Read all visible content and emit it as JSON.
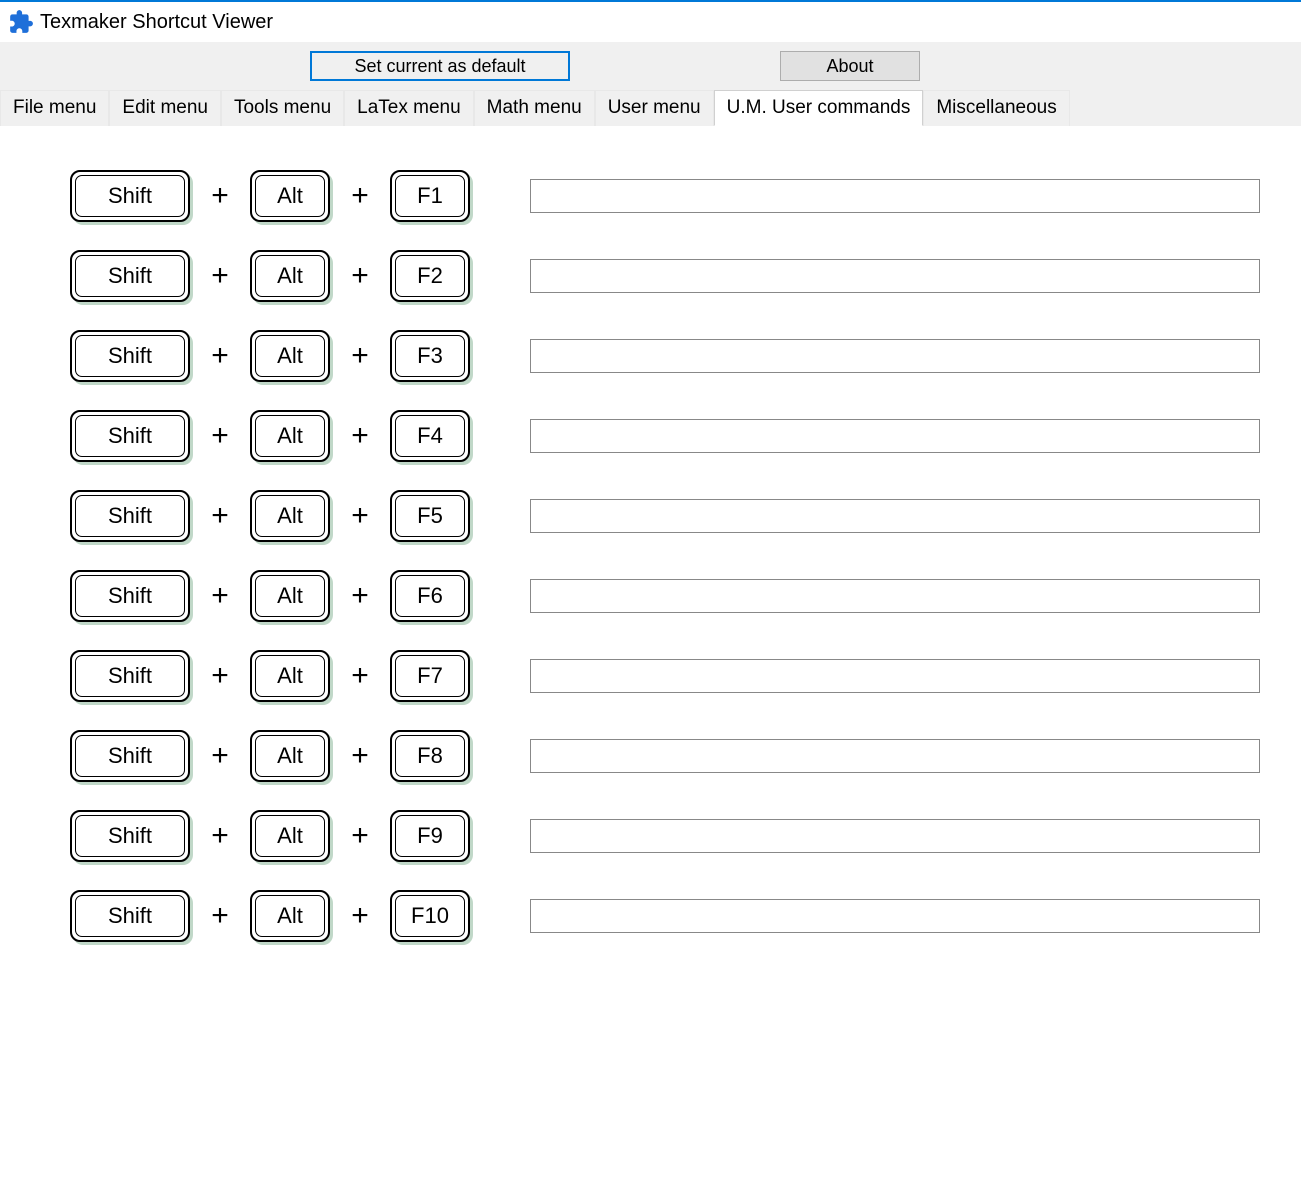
{
  "title": "Texmaker Shortcut Viewer",
  "buttons": {
    "set_default": "Set current as default",
    "about": "About"
  },
  "tabs": [
    {
      "label": "File menu",
      "active": false
    },
    {
      "label": "Edit menu",
      "active": false
    },
    {
      "label": "Tools menu",
      "active": false
    },
    {
      "label": "LaTex menu",
      "active": false
    },
    {
      "label": "Math menu",
      "active": false
    },
    {
      "label": "User menu",
      "active": false
    },
    {
      "label": "U.M. User commands",
      "active": true
    },
    {
      "label": "Miscellaneous",
      "active": false
    }
  ],
  "plus_symbol": "+",
  "shortcuts": [
    {
      "mod1": "Shift",
      "mod2": "Alt",
      "fn": "F1",
      "value": ""
    },
    {
      "mod1": "Shift",
      "mod2": "Alt",
      "fn": "F2",
      "value": ""
    },
    {
      "mod1": "Shift",
      "mod2": "Alt",
      "fn": "F3",
      "value": ""
    },
    {
      "mod1": "Shift",
      "mod2": "Alt",
      "fn": "F4",
      "value": ""
    },
    {
      "mod1": "Shift",
      "mod2": "Alt",
      "fn": "F5",
      "value": ""
    },
    {
      "mod1": "Shift",
      "mod2": "Alt",
      "fn": "F6",
      "value": ""
    },
    {
      "mod1": "Shift",
      "mod2": "Alt",
      "fn": "F7",
      "value": ""
    },
    {
      "mod1": "Shift",
      "mod2": "Alt",
      "fn": "F8",
      "value": ""
    },
    {
      "mod1": "Shift",
      "mod2": "Alt",
      "fn": "F9",
      "value": ""
    },
    {
      "mod1": "Shift",
      "mod2": "Alt",
      "fn": "F10",
      "value": ""
    }
  ]
}
